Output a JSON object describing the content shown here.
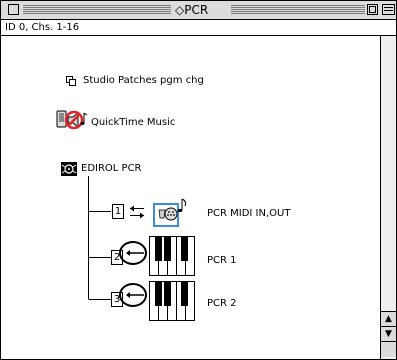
{
  "window": {
    "title": "◇PCR",
    "info": "ID 0, Chs. 1-16"
  },
  "items": {
    "studio_patches": "Studio Patches pgm chg",
    "quicktime": "QuickTime Music",
    "edirol": "EDIROL PCR"
  },
  "ports": [
    {
      "number": "1",
      "label": "PCR MIDI IN,OUT"
    },
    {
      "number": "2",
      "label": "PCR 1"
    },
    {
      "number": "3",
      "label": "PCR 2"
    }
  ],
  "colors": {
    "accent": "#3a8fd6",
    "forbidden": "#e0242b"
  }
}
